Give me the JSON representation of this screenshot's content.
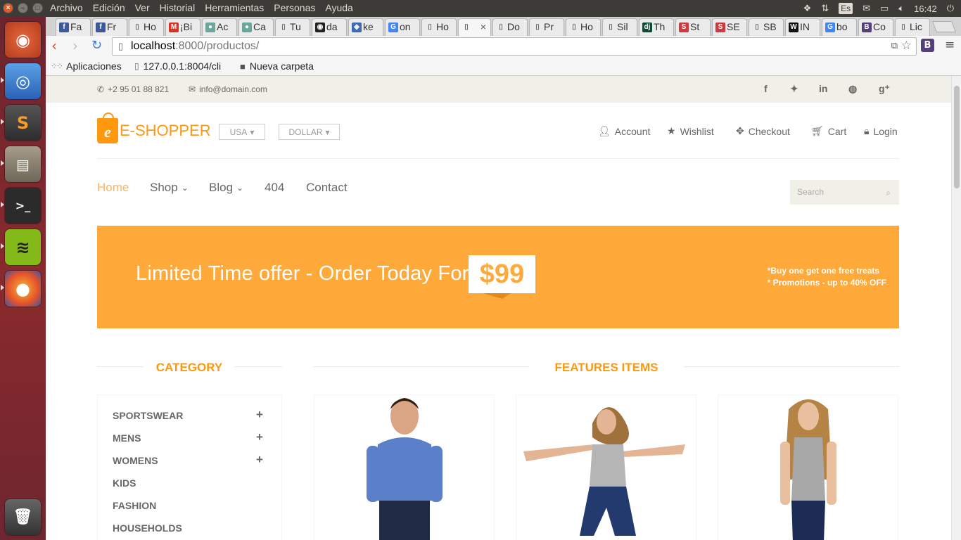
{
  "os": {
    "menu": [
      "Archivo",
      "Edición",
      "Ver",
      "Historial",
      "Herramientas",
      "Personas",
      "Ayuda"
    ],
    "keyboard_layout": "Es",
    "clock": "16:42"
  },
  "browser": {
    "tabs": [
      {
        "label": "Fa",
        "icon": "facebook-icon"
      },
      {
        "label": "Fr",
        "icon": "facebook-icon"
      },
      {
        "label": "Ho",
        "icon": "page-icon"
      },
      {
        "label": "¡Bi",
        "icon": "gmail-icon"
      },
      {
        "label": "Ac",
        "icon": "web-icon"
      },
      {
        "label": "Ca",
        "icon": "web-icon"
      },
      {
        "label": "Tu",
        "icon": "page-icon"
      },
      {
        "label": "da",
        "icon": "github-icon"
      },
      {
        "label": "ke",
        "icon": "shield-icon"
      },
      {
        "label": "on",
        "icon": "google-icon"
      },
      {
        "label": "Ho",
        "icon": "page-icon"
      },
      {
        "label": "",
        "icon": "page-icon",
        "active": true
      },
      {
        "label": "Do",
        "icon": "page-icon"
      },
      {
        "label": "Pr",
        "icon": "page-icon"
      },
      {
        "label": "Ho",
        "icon": "page-icon"
      },
      {
        "label": "Sil",
        "icon": "page-icon"
      },
      {
        "label": "Th",
        "icon": "django-icon"
      },
      {
        "label": "St",
        "icon": "s-icon"
      },
      {
        "label": "SE",
        "icon": "s-icon"
      },
      {
        "label": "SB",
        "icon": "page-icon"
      },
      {
        "label": "IN",
        "icon": "w-icon"
      },
      {
        "label": "bo",
        "icon": "google-icon"
      },
      {
        "label": "Co",
        "icon": "b-icon"
      },
      {
        "label": "Lic",
        "icon": "page-icon"
      }
    ],
    "url_host": "localhost",
    "url_rest": ":8000/productos/",
    "bookmarks": [
      "Aplicaciones",
      "127.0.0.1:8004/cli",
      "Nueva carpeta"
    ]
  },
  "site": {
    "phone": "+2 95 01 88 821",
    "email": "info@domain.com",
    "logo_e": "e",
    "logo_text": "E-SHOPPER",
    "country_dropdown": "USA",
    "currency_dropdown": "DOLLAR",
    "account_links": [
      "Account",
      "Wishlist",
      "Checkout",
      "Cart",
      "Login"
    ],
    "nav": [
      "Home",
      "Shop",
      "Blog",
      "404",
      "Contact"
    ],
    "search_placeholder": "Search",
    "banner": {
      "title": "Limited Time offer - Order Today For",
      "price": "$99",
      "note1": "*Buy one get one free treats",
      "note2": "* Promotions - up to 40% OFF"
    },
    "category_title": "CATEGORY",
    "features_title": "FEATURES ITEMS",
    "categories": [
      {
        "name": "SPORTSWEAR",
        "expandable": true
      },
      {
        "name": "MENS",
        "expandable": true
      },
      {
        "name": "WOMENS",
        "expandable": true
      },
      {
        "name": "KIDS",
        "expandable": false
      },
      {
        "name": "FASHION",
        "expandable": false
      },
      {
        "name": "HOUSEHOLDS",
        "expandable": false
      }
    ],
    "accent_color": "#fe980f",
    "banner_color": "#fea93a"
  }
}
